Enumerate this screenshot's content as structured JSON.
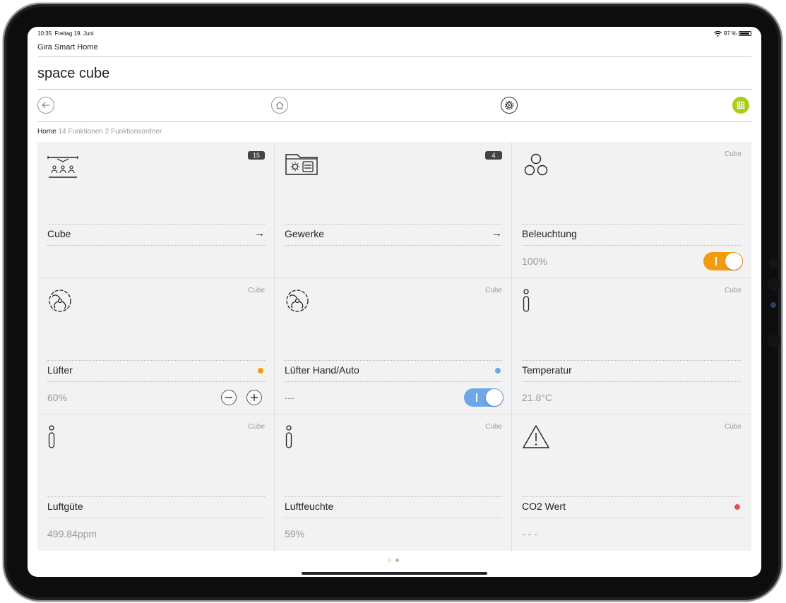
{
  "status_bar": {
    "time": "10:35",
    "date": "Freitag 19. Juni",
    "battery": "97 %"
  },
  "app_name": "Gira Smart Home",
  "page_title": "space cube",
  "nav": {
    "active_color": "#a7cf14"
  },
  "breadcrumb": {
    "home": "Home",
    "functions": "14 Funktionen",
    "folders": "2 Funktionsordner"
  },
  "tiles": [
    {
      "name": "Cube",
      "badge": "15",
      "icon": "room-people-icon"
    },
    {
      "name": "Gewerke",
      "badge": "4",
      "icon": "trades-folder-icon"
    },
    {
      "name": "Beleuchtung",
      "tag": "Cube",
      "value": "100%",
      "icon": "lights-group-icon",
      "toggle_on": true,
      "toggle_color": "#f39b0f"
    },
    {
      "name": "Lüfter",
      "tag": "Cube",
      "value": "60%",
      "icon": "fan-icon",
      "status_color": "#f39b0f"
    },
    {
      "name": "Lüfter Hand/Auto",
      "tag": "Cube",
      "value": "---",
      "icon": "fan-icon",
      "status_color": "#6ea6ea",
      "toggle_on": true,
      "toggle_color": "#6ea6ea"
    },
    {
      "name": "Temperatur",
      "tag": "Cube",
      "value": "21.8°C",
      "icon": "info-icon"
    },
    {
      "name": "Luftgüte",
      "tag": "Cube",
      "value": "499.84ppm",
      "icon": "info-icon"
    },
    {
      "name": "Luftfeuchte",
      "tag": "Cube",
      "value": "59%",
      "icon": "info-icon"
    },
    {
      "name": "CO2 Wert",
      "tag": "Cube",
      "value": "- - -",
      "icon": "warning-icon",
      "status_color": "#e65252"
    }
  ],
  "pager": {
    "pages": 2,
    "current": 1
  }
}
